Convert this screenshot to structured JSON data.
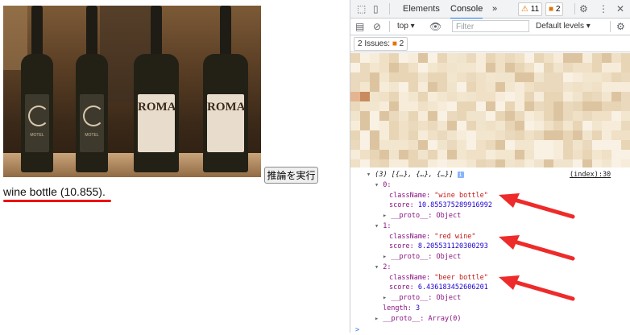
{
  "page": {
    "button_label": "推論を実行",
    "result_text": "wine bottle (10.855).",
    "photo_labels": [
      "MOTEL",
      "MOTEL",
      "ROMA",
      "ROMA"
    ]
  },
  "devtools": {
    "tabs": [
      "Elements",
      "Console"
    ],
    "active_tab": "Console",
    "more_tabs": "»",
    "warnings_count": "11",
    "issues_badge_count": "2",
    "context": "top",
    "filter_placeholder": "Filter",
    "levels": "Default levels",
    "issues_label": "2 Issues:",
    "issues_count": "2",
    "log": {
      "summary": "(3) [{…}, {…}, {…}]",
      "source": "(index):30",
      "items": [
        {
          "index": "0:",
          "className": "\"wine bottle\"",
          "score": "10.855375289916992",
          "proto": "__proto__: Object"
        },
        {
          "index": "1:",
          "className": "\"red wine\"",
          "score": "8.205531120300293",
          "proto": "__proto__: Object"
        },
        {
          "index": "2:",
          "className": "\"beer bottle\"",
          "score": "6.436183452606201",
          "proto": "__proto__: Object"
        }
      ],
      "length_key": "length:",
      "length_value": "3",
      "array_proto": "__proto__: Array(0)",
      "prompt": ">"
    }
  },
  "colors": {
    "accent": "#1a73e8",
    "arrow": "#ee2b2b",
    "underline": "#e11111"
  }
}
